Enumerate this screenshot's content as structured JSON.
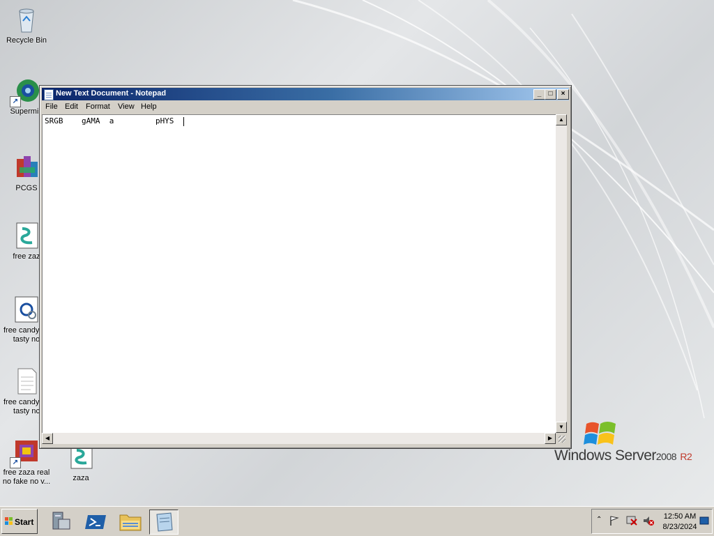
{
  "desktop": {
    "icons": [
      {
        "label": "Recycle Bin"
      },
      {
        "label": "Supermiu"
      },
      {
        "label": "PCGS"
      },
      {
        "label": "free zaz"
      },
      {
        "label": "free candy so tasty no"
      },
      {
        "label": "free candy so tasty nc"
      },
      {
        "label": "free zaza real no fake no v..."
      },
      {
        "label": "zaza"
      }
    ],
    "branding": {
      "name": "Windows Server",
      "version": "2008",
      "edition": "R2"
    }
  },
  "notepad": {
    "title": "New Text Document - Notepad",
    "menu": [
      "File",
      "Edit",
      "Format",
      "View",
      "Help"
    ],
    "content": "SRGB    gAMA  a         pHYS  ",
    "controls": {
      "minimize": "_",
      "maximize": "□",
      "close": "×"
    }
  },
  "taskbar": {
    "start_label": "Start",
    "apps": [
      "server-manager-icon",
      "powershell-icon",
      "file-explorer-icon",
      "notepad-icon"
    ],
    "tray": {
      "time": "12:50 AM",
      "date": "8/23/2024"
    }
  },
  "colors": {
    "titlebar": "#0a246a",
    "taskbar": "#d4d0c8",
    "brand_accent": "#c0392b"
  }
}
